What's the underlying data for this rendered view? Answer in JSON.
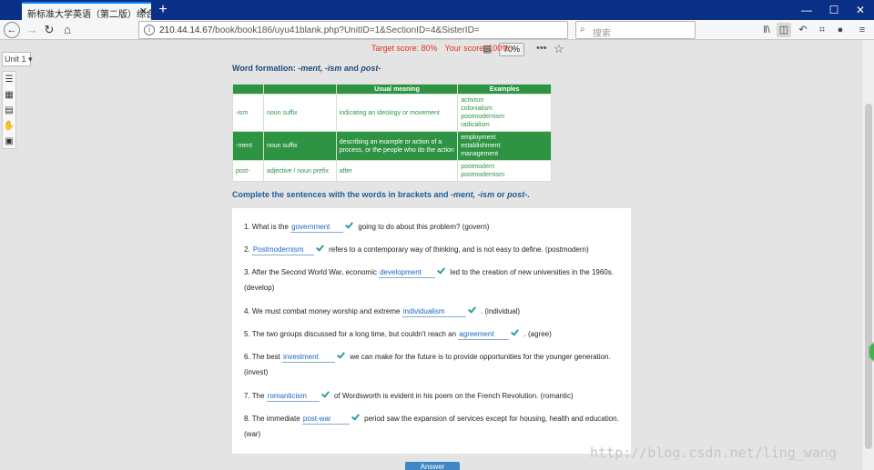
{
  "browser": {
    "tab_title": "新标准大学英语（第二版）综合教程",
    "tab_close": "✕",
    "new_tab": "+",
    "window_controls": [
      "—",
      "☐",
      "✕"
    ],
    "url_host": "210.44.14.67",
    "url_path": "/book/book186/uyu41blank.php?UnitID=1&SectionID=4&SisterID=",
    "zoom": "70%",
    "search_placeholder": "搜索"
  },
  "sidebar": {
    "unit_selector": "Unit 1 ▾"
  },
  "score": {
    "target": "Target score: 80%",
    "yours": "Your score: 100%"
  },
  "section": {
    "title_prefix": "Word formation: ",
    "title_terms": "-ment, -ism",
    "title_and": " and ",
    "title_post": "post-"
  },
  "table": {
    "headers": [
      "",
      "",
      "Usual meaning",
      "Examples"
    ],
    "rows": [
      {
        "affix": "-ism",
        "type": "noun suffix",
        "meaning": "indicating an ideology or movement",
        "examples": [
          "activism",
          "colonialism",
          "postmodernism",
          "radicalism"
        ]
      },
      {
        "affix": "-ment",
        "type": "noun suffix",
        "meaning": "describing an example or action of a process, or the people who do the action",
        "examples": [
          "employment",
          "establishment",
          "management"
        ]
      },
      {
        "affix": "post-",
        "type": "adjective / noun prefix",
        "meaning": "after",
        "examples": [
          "postmodern",
          "postmodernism"
        ]
      }
    ]
  },
  "instruction": {
    "text": "Complete the sentences with the words in brackets and ",
    "terms": "-ment, -ism",
    "or": " or ",
    "post": "post-",
    "end": "."
  },
  "questions": [
    {
      "before": "1. What is the ",
      "answer": "government",
      "after": " going to do about this problem? (govern)"
    },
    {
      "before": "2. ",
      "answer": "Postmodernism",
      "after": " refers to a contemporary way of thinking, and is not easy to define. (postmodern)"
    },
    {
      "before": "3. After the Second World War, economic ",
      "answer": "development",
      "after": " led to the creation of new universities in the 1960s. (develop)"
    },
    {
      "before": "4. We must combat money worship and extreme ",
      "answer": "individualism",
      "after": " . (individual)"
    },
    {
      "before": "5. The two groups discussed for a long time, but couldn't reach an ",
      "answer": "agreement",
      "after": " . (agree)"
    },
    {
      "before": "6. The best ",
      "answer": "investment",
      "after": " we can make for the future is to provide opportunities for the younger generation. (invest)"
    },
    {
      "before": "7. The ",
      "answer": "romanticism",
      "after": " of Wordsworth is evident in his poem on the French Revolution. (romantic)"
    },
    {
      "before": "8. The immediate ",
      "answer": "post-war",
      "after": " period saw the expansion of services except for housing, health and education. (war)"
    }
  ],
  "answer_button": "Answer",
  "watermark": "http://blog.csdn.net/ling_wang"
}
